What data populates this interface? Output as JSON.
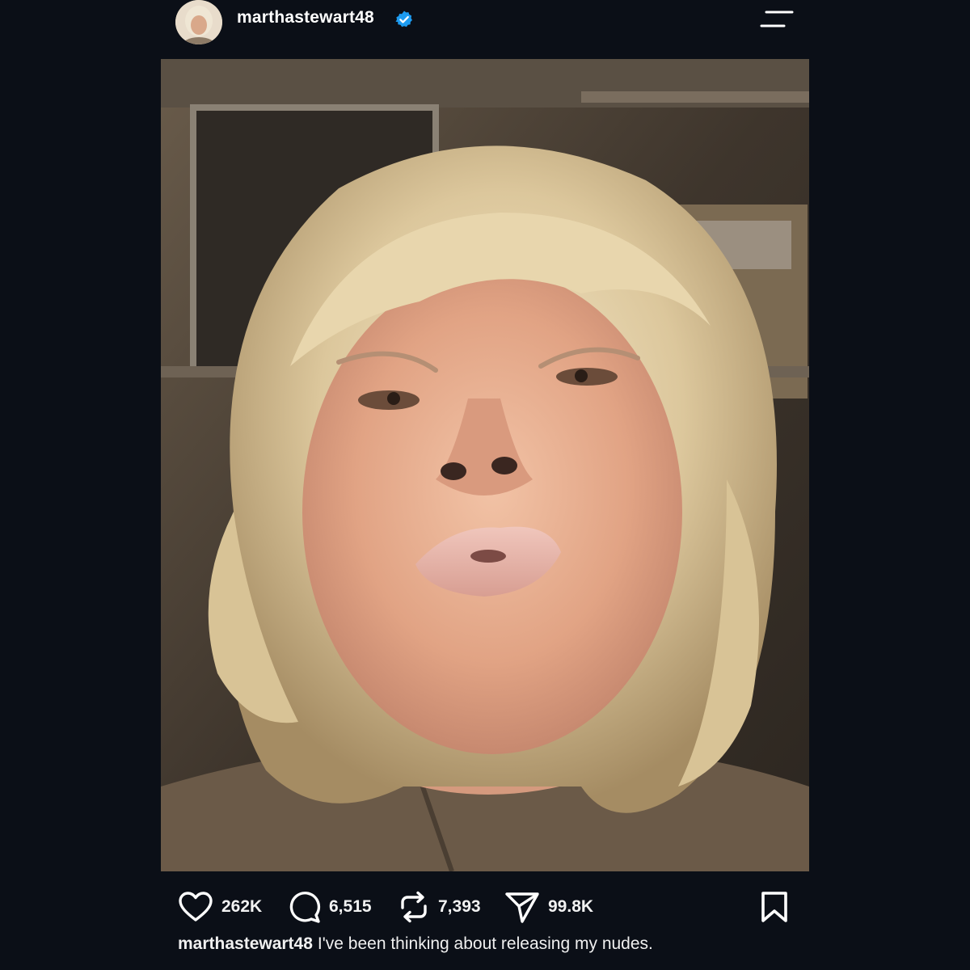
{
  "post": {
    "username": "marthastewart48",
    "verified": true,
    "colors": {
      "background": "#0b0f17",
      "verified_badge": "#1d9bf0",
      "text": "#ffffff"
    },
    "icons": {
      "menu": "menu-icon",
      "like": "heart-icon",
      "comment": "comment-icon",
      "repost": "repost-icon",
      "share": "send-icon",
      "bookmark": "bookmark-icon",
      "verified": "verified-badge-icon"
    },
    "stats": {
      "likes": "262K",
      "comments": "6,515",
      "reposts": "7,393",
      "shares": "99.8K"
    },
    "caption": {
      "username": "marthastewart48",
      "text": "I've been thinking about releasing my nudes."
    }
  }
}
